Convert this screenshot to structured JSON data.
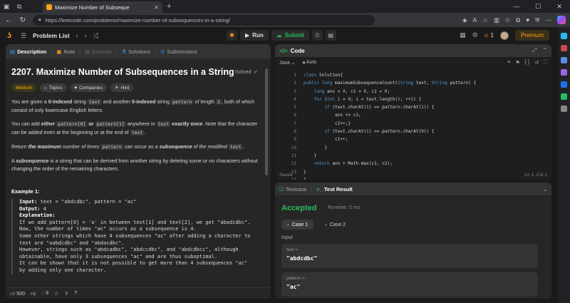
{
  "browser": {
    "tab_title": "Maximize Number of Subseque",
    "url": "https://leetcode.com/problems/maximize-number-of-subsequences-in-a-string/"
  },
  "header": {
    "problem_list": "Problem List",
    "run": "Run",
    "submit": "Submit",
    "streak": "1",
    "premium": "Premium"
  },
  "left_tabs": [
    {
      "label": "Description"
    },
    {
      "label": "Note"
    },
    {
      "label": "Editorial"
    },
    {
      "label": "Solutions"
    },
    {
      "label": "Submissions"
    }
  ],
  "problem": {
    "title": "2207. Maximize Number of Subsequences in a String",
    "solved": "Solved",
    "difficulty": "Medium",
    "chips": [
      "Topics",
      "Companies",
      "Hint"
    ],
    "p1_a": "You are given a ",
    "p1_b": "0-indexed",
    "p1_c": " string ",
    "p1_d": "text",
    "p1_e": " and another ",
    "p1_f": "0-indexed",
    "p1_g": " string ",
    "p1_h": "pattern",
    "p1_i": " of length ",
    "p1_j": "2",
    "p1_k": ", both of which consist of only lowercase English letters.",
    "p2_a": "You can add ",
    "p2_b": "either",
    "p2_c": "pattern[0]",
    "p2_d": "or",
    "p2_e": "pattern[1]",
    "p2_f": " anywhere in ",
    "p2_g": "text",
    "p2_h": "exactly once",
    "p2_i": ". Note that the character can be added even at the beginning or at the end of ",
    "p2_j": "text",
    "p3_a": "Return ",
    "p3_b": "the maximum",
    "p3_c": " number of times ",
    "p3_d": "pattern",
    "p3_e": " can occur as a ",
    "p3_f": "subsequence",
    "p3_g": " of the modified ",
    "p3_h": "text",
    "p4_a": "A ",
    "p4_b": "subsequence",
    "p4_c": " is a string that can be derived from another string by deleting some or no characters without changing the order of the remaining characters.",
    "example_title": "Example 1:",
    "ex_input_label": "Input:",
    "ex_input": " text = \"abdcdbc\", pattern = \"ac\"",
    "ex_output_label": "Output:",
    "ex_output": " 4",
    "ex_expl_label": "Explanation:",
    "ex_expl": "If we add pattern[0] = 'a' in between text[1] and text[2], we get \"abadcdbc\".\nNow, the number of times \"ac\" occurs as a subsequence is 4.\nSome other strings which have 4 subsequences \"ac\" after adding a character to\ntext are \"aabdcdbc\" and \"abdacdbc\".\nHowever, strings such as \"abdcadbc\", \"abdccdbc\", and \"abdcdbcc\", although\nobtainable, have only 3 subsequences \"ac\" and are thus suboptimal.\nIt can be shown that it is not possible to get more than 4 subsequences \"ac\"\nby adding only one character."
  },
  "left_footer": {
    "likes": "500",
    "comments": "8"
  },
  "code_panel": {
    "title": "Code",
    "language": "Java",
    "mode": "Auto",
    "lines": [
      "class Solution{",
      "public long maximumSubsequenceCount(String text, String pattern) {",
      "    long ans = 0, c1 = 0, c2 = 0;",
      "    for (int i = 0; i < text.length(); ++i) {",
      "        if (text.charAt(i) == pattern.charAt(1)) {",
      "            ans += c1;",
      "            c2++;}",
      "        if (text.charAt(i) == pattern.charAt(0)) {",
      "            c1++;",
      "        }",
      "    }",
      "    return ans + Math.max(c1, c2);",
      "}",
      "}"
    ],
    "line_numbers": [
      "1",
      "2",
      "3",
      "4",
      "5",
      "6",
      "7",
      "8",
      "9",
      "10",
      "11",
      "12",
      "13",
      "14"
    ],
    "status": "Saved",
    "cursor": "Ln 1, Col 1"
  },
  "test_panel": {
    "tab_testcase": "Testcase",
    "tab_result": "Test Result",
    "verdict": "Accepted",
    "runtime": "Runtime: 0 ms",
    "case1": "Case 1",
    "case2": "Case 2",
    "input_label": "Input",
    "text_label": "text =",
    "text_value": "\"abdcdbc\"",
    "pattern_label": "pattern =",
    "pattern_value": "\"ac\""
  }
}
